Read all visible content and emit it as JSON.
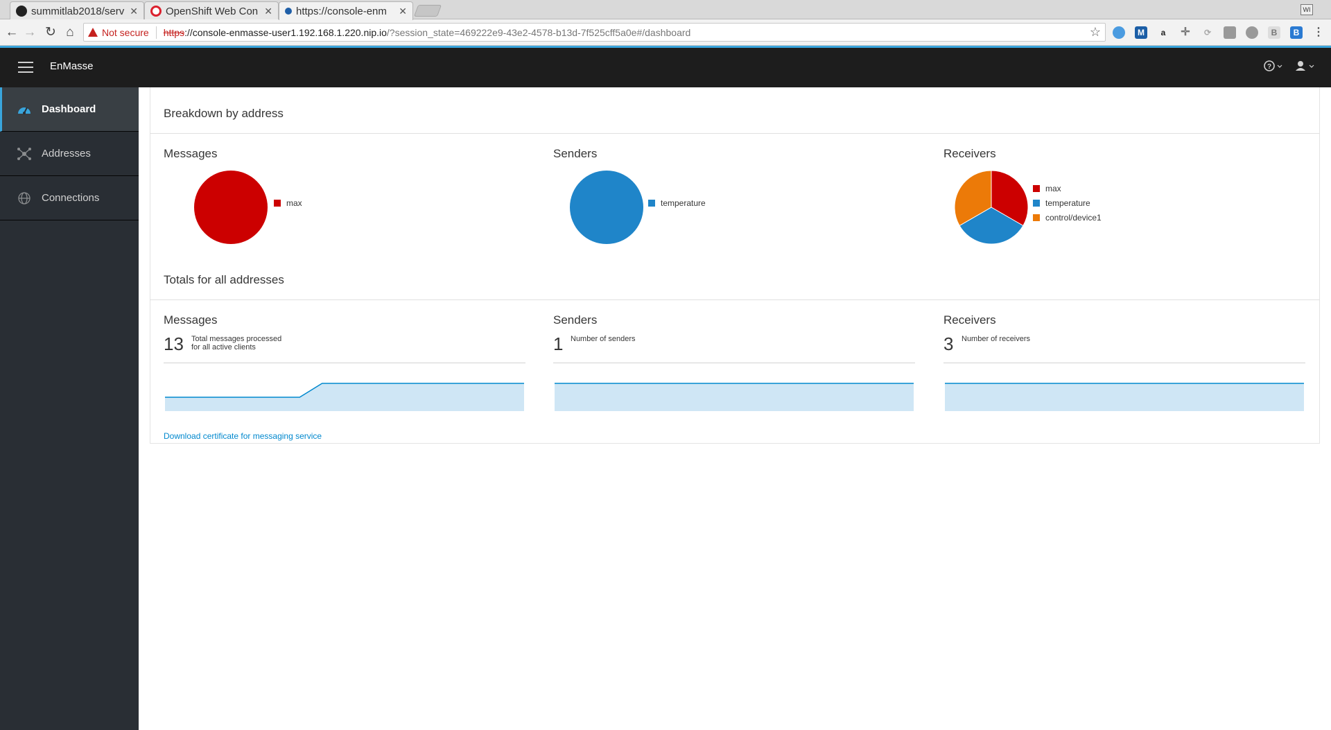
{
  "browser": {
    "tabs": [
      {
        "title": "summitlab2018/serv",
        "favicon": "github-icon"
      },
      {
        "title": "OpenShift Web Con",
        "favicon": "openshift-icon"
      },
      {
        "title": "https://console-enm",
        "favicon": "enmasse-icon"
      }
    ],
    "security_label": "Not secure",
    "url_protocol": "https",
    "url_host": "://console-enmasse-user1.192.168.1.220.nip.io",
    "url_rest": "/?session_state=469222e9-43e2-4578-b13d-7f525cff5a0e#/dashboard"
  },
  "app": {
    "brand": "EnMasse"
  },
  "sidebar": {
    "items": [
      {
        "label": "Dashboard",
        "icon": "dashboard-icon",
        "active": true
      },
      {
        "label": "Addresses",
        "icon": "network-icon",
        "active": false
      },
      {
        "label": "Connections",
        "icon": "globe-icon",
        "active": false
      }
    ]
  },
  "breakdown": {
    "title": "Breakdown by address",
    "messages": {
      "title": "Messages",
      "legend": [
        "max"
      ]
    },
    "senders": {
      "title": "Senders",
      "legend": [
        "temperature"
      ]
    },
    "receivers": {
      "title": "Receivers",
      "legend": [
        "max",
        "temperature",
        "control/device1"
      ]
    }
  },
  "totals": {
    "title": "Totals for all addresses",
    "messages": {
      "title": "Messages",
      "value": "13",
      "desc1": "Total messages processed",
      "desc2": "for all active clients"
    },
    "senders": {
      "title": "Senders",
      "value": "1",
      "desc1": "Number of senders"
    },
    "receivers": {
      "title": "Receivers",
      "value": "3",
      "desc1": "Number of receivers"
    }
  },
  "download_link": "Download certificate for messaging service",
  "colors": {
    "red": "#cc0000",
    "blue": "#1f85c9",
    "orange": "#ec7a08",
    "accent": "#39a5dc",
    "spark_fill": "#cfe6f5"
  },
  "chart_data": [
    {
      "type": "pie",
      "title": "Messages",
      "categories": [
        "max"
      ],
      "values": [
        1
      ]
    },
    {
      "type": "pie",
      "title": "Senders",
      "categories": [
        "temperature"
      ],
      "values": [
        1
      ]
    },
    {
      "type": "pie",
      "title": "Receivers",
      "categories": [
        "max",
        "temperature",
        "control/device1"
      ],
      "values": [
        1,
        1,
        1
      ]
    },
    {
      "type": "area",
      "title": "Messages",
      "values": [
        0.5,
        0.5,
        0.5,
        0.5,
        0.5,
        0.5,
        0.5,
        1,
        1,
        1,
        1,
        1,
        1,
        1,
        1,
        1,
        1
      ]
    },
    {
      "type": "area",
      "title": "Senders",
      "values": [
        1,
        1,
        1,
        1,
        1,
        1,
        1,
        1,
        1,
        1,
        1,
        1,
        1,
        1,
        1,
        1,
        1
      ]
    },
    {
      "type": "area",
      "title": "Receivers",
      "values": [
        1,
        1,
        1,
        1,
        1,
        1,
        1,
        1,
        1,
        1,
        1,
        1,
        1,
        1,
        1,
        1,
        1
      ]
    }
  ]
}
